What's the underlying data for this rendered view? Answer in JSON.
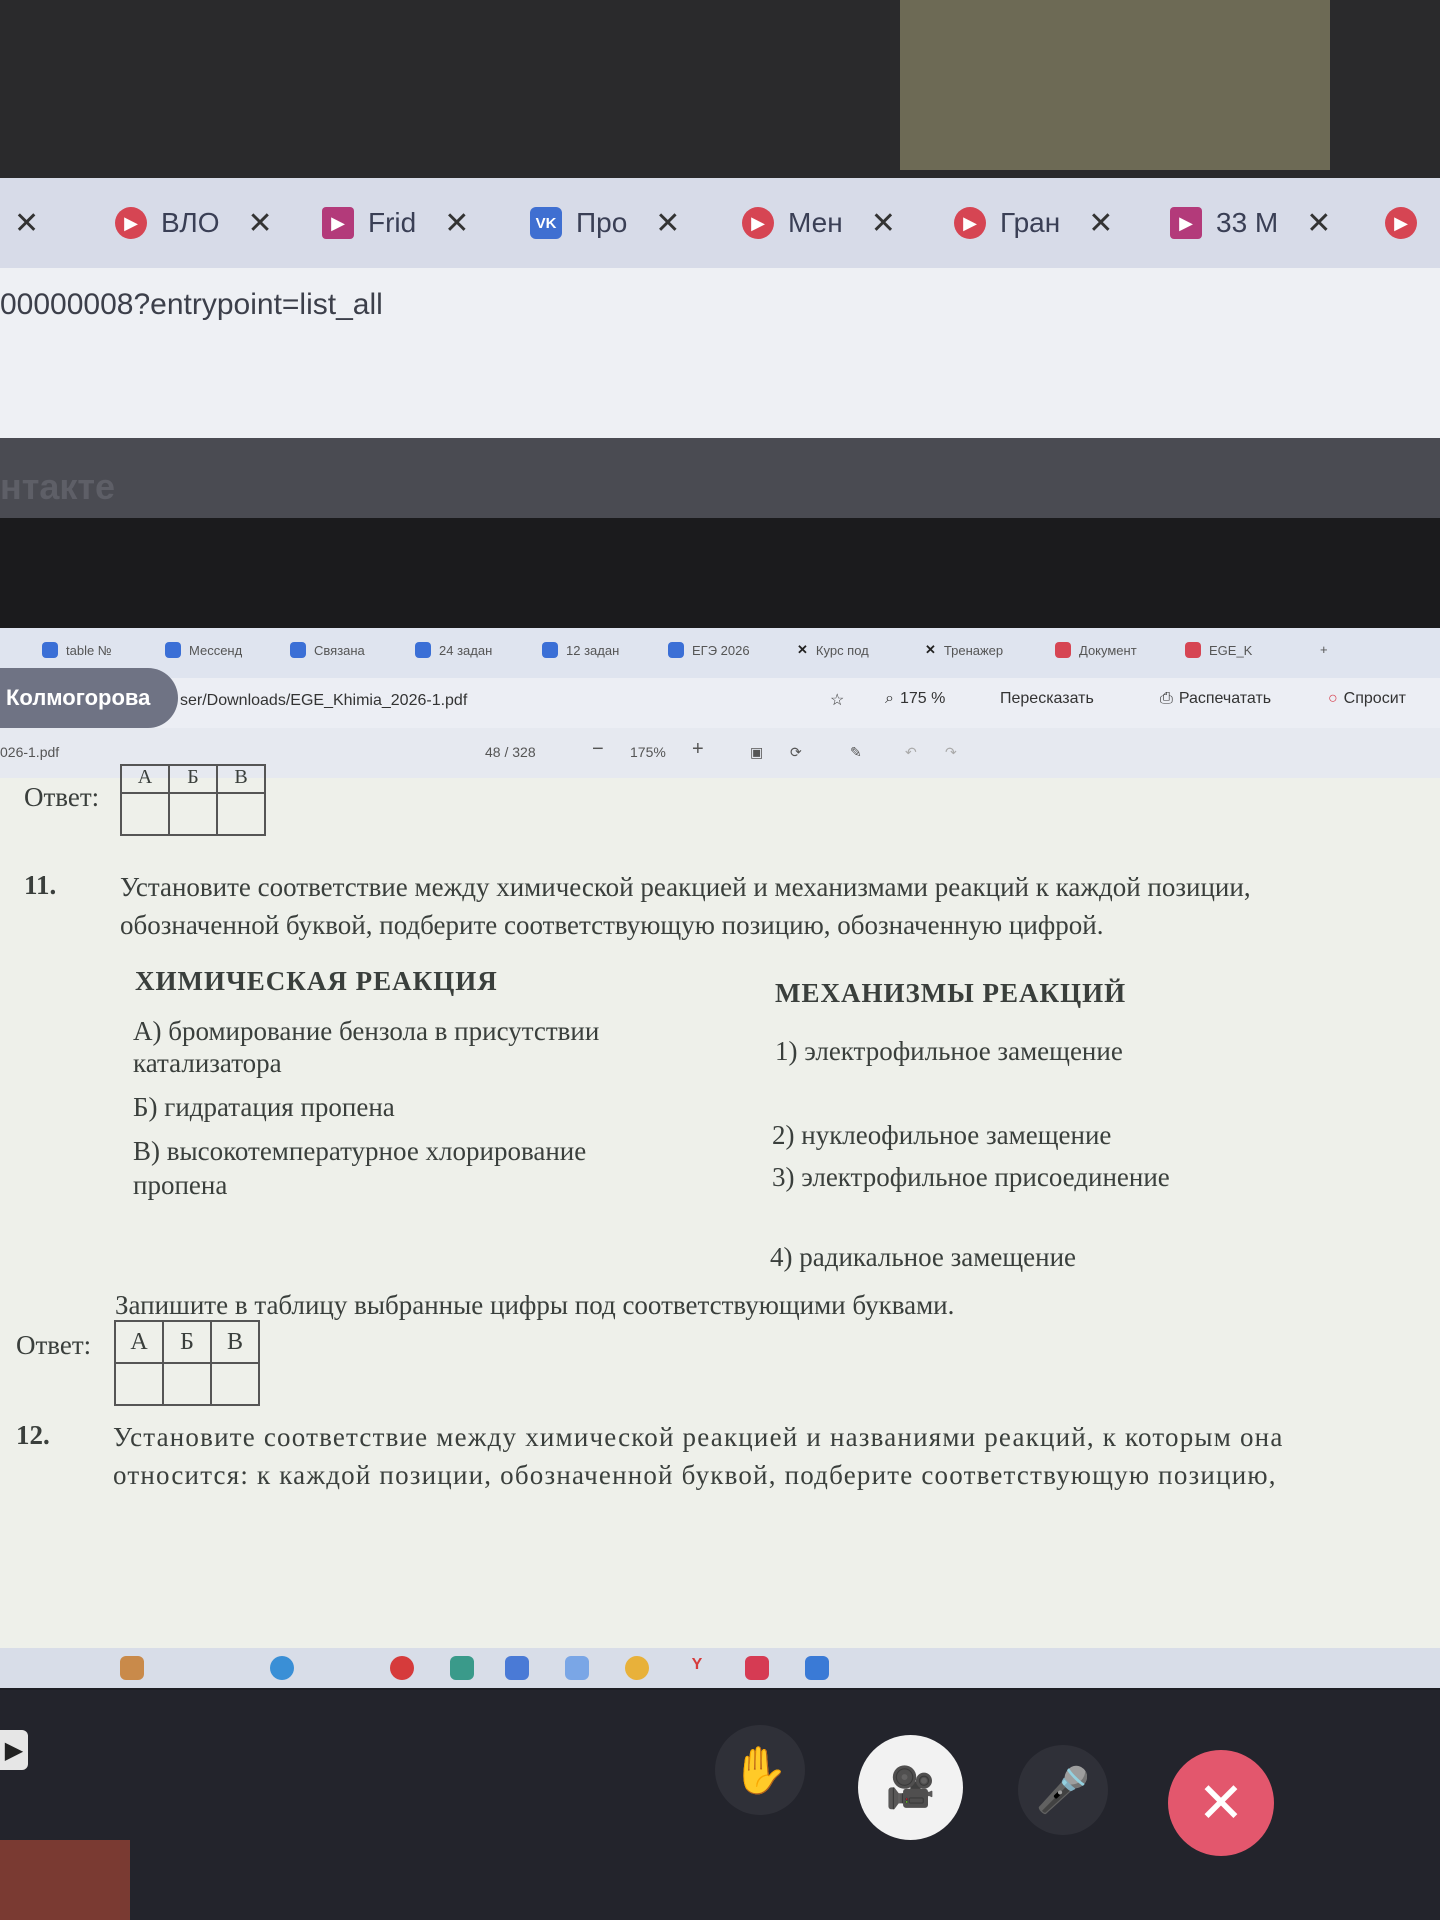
{
  "outer_browser": {
    "tabs": [
      {
        "label": "ВЛО",
        "icon": "play-icon"
      },
      {
        "label": "Frid",
        "icon": "play-icon"
      },
      {
        "label": "Про",
        "icon": "vk-icon"
      },
      {
        "label": "Мен",
        "icon": "play-icon"
      },
      {
        "label": "Гран",
        "icon": "play-icon"
      },
      {
        "label": "33 М",
        "icon": "play-icon"
      }
    ],
    "close_glyph": "✕",
    "url": "00000008?entrypoint=list_all",
    "page_title_fragment": "нтакте"
  },
  "inner_browser": {
    "tabs": [
      "table №",
      "Мессенд",
      "Связана",
      "24 задан",
      "12 задан",
      "ЕГЭ 2026",
      "Курс под",
      "Тренажер",
      "Документ",
      "EGE_K"
    ],
    "user_name": "Колмогорова",
    "file_path": "ser/Downloads/EGE_Khimia_2026-1.pdf",
    "zoom_label": "175 %",
    "retell_label": "Пересказать",
    "print_label": "Распечатать",
    "ask_label": "Спросит",
    "file_name": "026-1.pdf",
    "page_indicator": "48 / 328",
    "zoom_value": "175%",
    "minus": "−",
    "plus": "+"
  },
  "document": {
    "prev_answer_label": "Ответ:",
    "prev_table_headers": [
      "А",
      "Б",
      "В"
    ],
    "q11": {
      "number": "11.",
      "line1": "Установите соответствие между химической реакцией и механизмами реакций к каждой позиции,",
      "line2": "обозначенной буквой, подберите соответствующую позицию, обозначенную цифрой.",
      "left_header": "ХИМИЧЕСКАЯ РЕАКЦИЯ",
      "right_header": "МЕХАНИЗМЫ РЕАКЦИЙ",
      "left_items": [
        [
          "А) бромирование бензола в присутствии",
          "катализатора"
        ],
        [
          "Б) гидратация пропена"
        ],
        [
          "В) высокотемпературное хлорирование",
          "пропена"
        ]
      ],
      "right_items": [
        "1) электрофильное замещение",
        "2) нуклеофильное замещение",
        "3) электрофильное присоединение",
        "4) радикальное замещение"
      ],
      "instruction": "Запишите в таблицу выбранные цифры под соответствующими буквами.",
      "answer_label": "Ответ:",
      "table_headers": [
        "А",
        "Б",
        "В"
      ]
    },
    "q12": {
      "number": "12.",
      "line1": "Установите соответствие между химической реакцией и названиями реакций, к которым она",
      "line2": "относится: к каждой позиции, обозначенной буквой, подберите соответствующую позицию,"
    }
  },
  "call_controls": {
    "hand_icon": "✋",
    "video_icon": "🎥",
    "mic_icon": "🎤",
    "end_icon": "✕",
    "left_arrow": "▶"
  },
  "colors": {
    "end_call": "#e3576d",
    "page_bg": "#eef0ea",
    "tab_accent": "#d64553"
  }
}
